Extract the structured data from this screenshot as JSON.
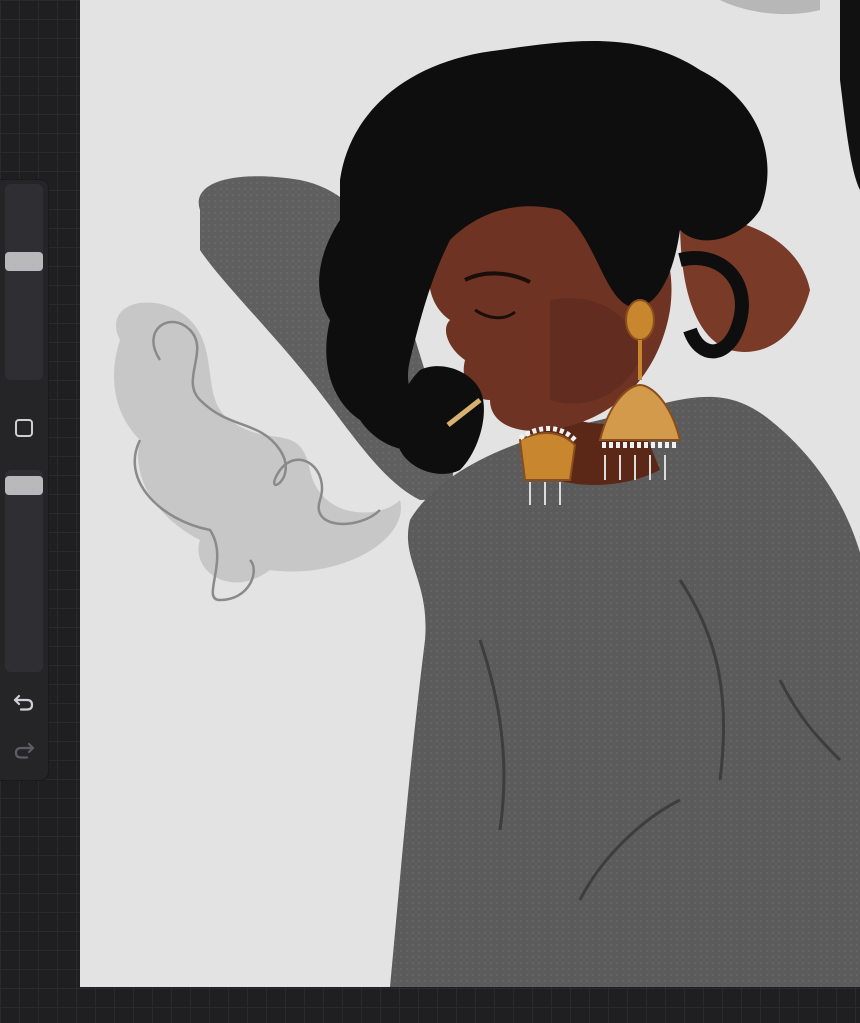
{
  "app": {
    "name": "drawing canvas"
  },
  "toolbar": {
    "size_slider": {
      "level_fraction": 0.28
    },
    "opacity_slider": {
      "level_fraction": 0.05
    },
    "modify_icon": "square-outline-icon",
    "undo_icon": "undo-arrow-icon",
    "redo_icon": "redo-arrow-icon"
  },
  "artwork": {
    "background_color": "#e3e3e3",
    "skin_color": "#6e3322",
    "hair_color": "#0c0c0c",
    "clothing_color": "#5c5c5c",
    "smoke_color": "#b8b8b8",
    "jewelry_color": "#c8862e"
  }
}
